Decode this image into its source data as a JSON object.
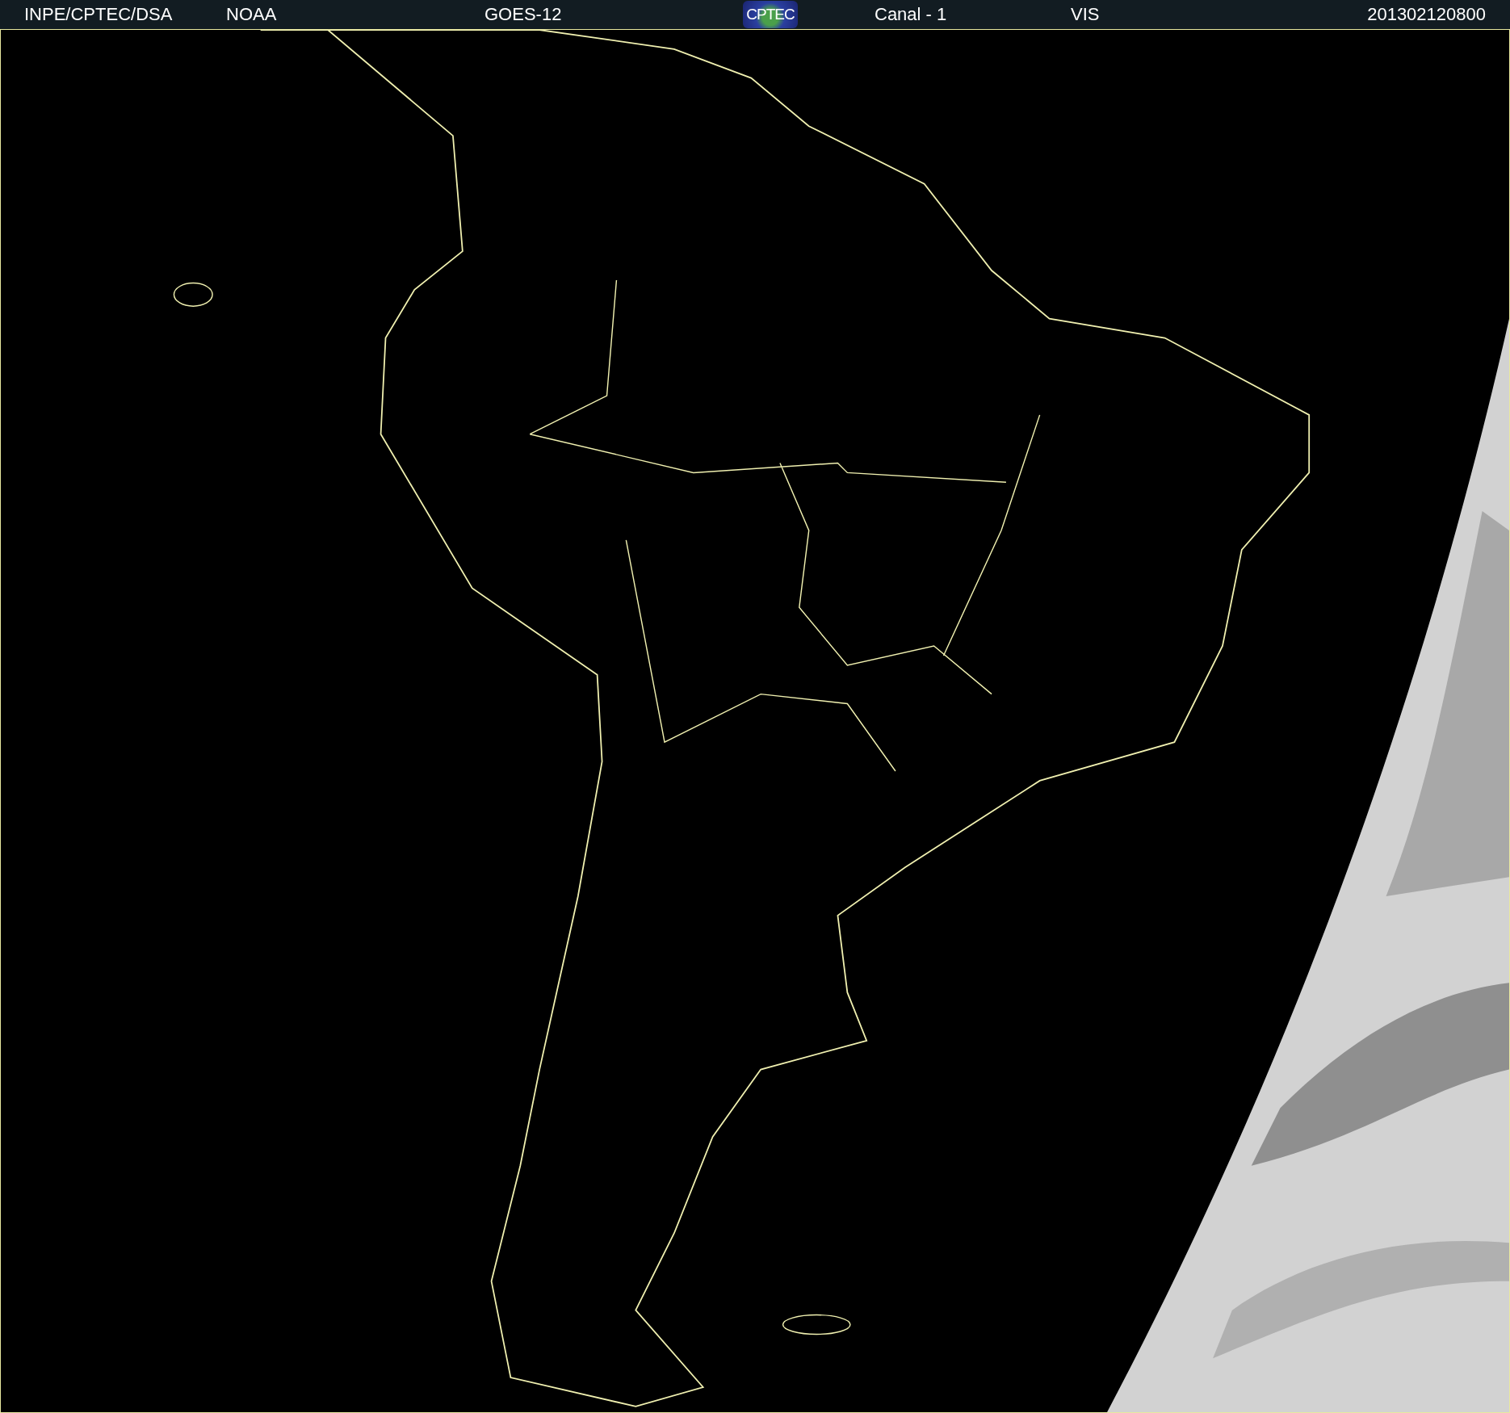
{
  "header": {
    "left": [
      {
        "text": "INPE/CPTEC/DSA",
        "kind": "source"
      },
      {
        "text": "NOAA",
        "kind": "agency"
      },
      {
        "text": "GOES-12",
        "kind": "satellite"
      }
    ],
    "logo": {
      "text": "CPTEC"
    },
    "right": [
      {
        "text": "Canal - 1",
        "kind": "channel"
      },
      {
        "text": "VIS",
        "kind": "band"
      },
      {
        "text": "201302120800",
        "kind": "timestamp"
      }
    ]
  }
}
